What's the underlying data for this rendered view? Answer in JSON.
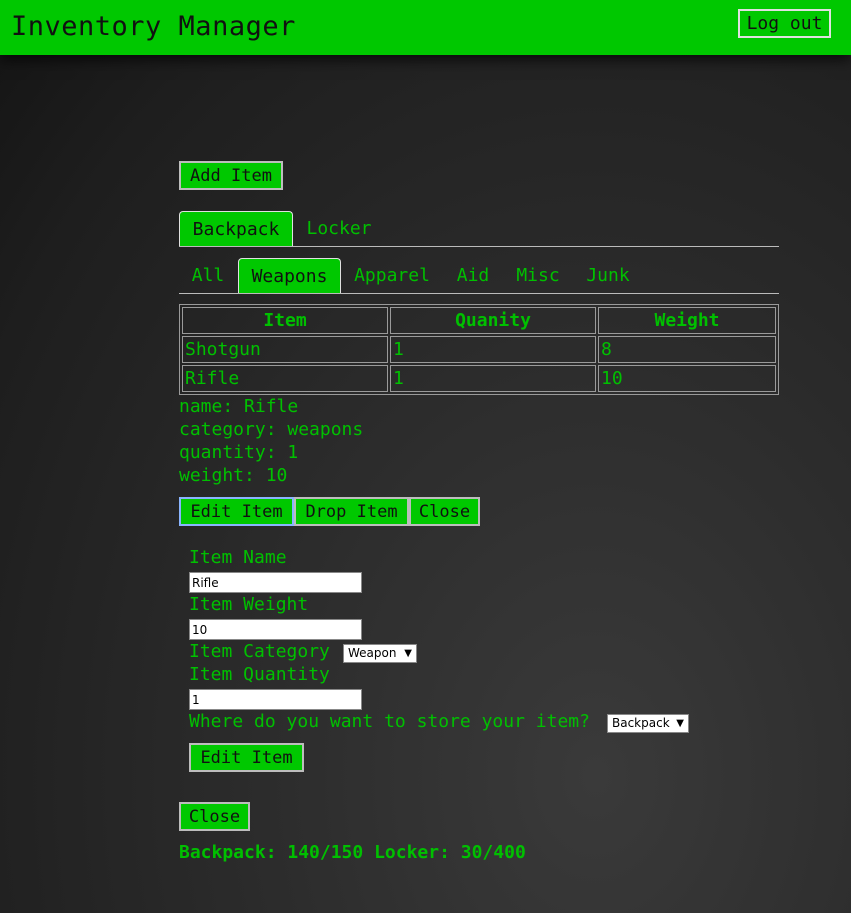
{
  "header": {
    "title": "Inventory Manager",
    "logout_label": "Log out"
  },
  "toolbar": {
    "add_item_label": "Add Item"
  },
  "storage_tabs": [
    {
      "label": "Backpack",
      "active": true
    },
    {
      "label": "Locker",
      "active": false
    }
  ],
  "category_tabs": [
    {
      "label": "All",
      "active": false
    },
    {
      "label": "Weapons",
      "active": true
    },
    {
      "label": "Apparel",
      "active": false
    },
    {
      "label": "Aid",
      "active": false
    },
    {
      "label": "Misc",
      "active": false
    },
    {
      "label": "Junk",
      "active": false
    }
  ],
  "table": {
    "headers": [
      "Item",
      "Quanity",
      "Weight"
    ],
    "rows": [
      [
        "Shotgun",
        "1",
        "8"
      ],
      [
        "Rifle",
        "1",
        "10"
      ]
    ]
  },
  "details": {
    "name": "name: Rifle",
    "category": "category: weapons",
    "quantity": "quantity: 1",
    "weight": "weight: 10"
  },
  "detail_actions": {
    "edit_label": "Edit Item",
    "drop_label": "Drop Item",
    "close_label": "Close"
  },
  "form": {
    "name_label": "Item Name",
    "name_value": "Rifle",
    "weight_label": "Item Weight",
    "weight_value": "10",
    "category_label": "Item Category",
    "category_value": "Weapon",
    "quantity_label": "Item Quantity",
    "quantity_value": "1",
    "store_label": "Where do you want to store your item?",
    "store_value": "Backpack",
    "submit_label": "Edit Item"
  },
  "close_label": "Close",
  "summary": "Backpack: 140/150 Locker: 30/400",
  "colors": {
    "accent": "#00c800",
    "text": "#00c000",
    "background": "#2a2a2a"
  }
}
